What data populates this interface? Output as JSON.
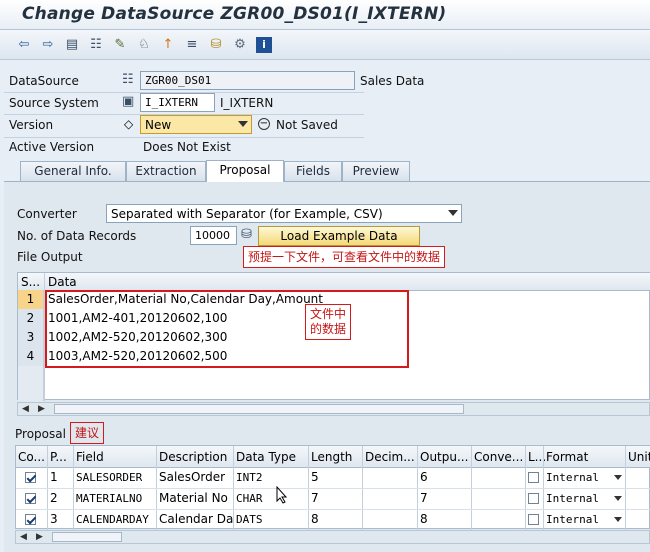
{
  "window": {
    "title": "Change DataSource ZGR00_DS01(I_IXTERN)"
  },
  "toolbar": {
    "icons": [
      "back-arrow-icon",
      "forward-arrow-icon",
      "display-icon",
      "hierarchy-icon",
      "edit-pencil-icon",
      "activate-icon",
      "info-marker-icon",
      "transport-icon",
      "database-icon",
      "settings-icon",
      "info-icon"
    ]
  },
  "header": {
    "datasource_label": "DataSource",
    "datasource_value": "ZGR00_DS01",
    "datasource_desc": "Sales Data",
    "source_system_label": "Source System",
    "source_system_value": "I_IXTERN",
    "source_system_desc": "I_IXTERN",
    "version_label": "Version",
    "version_value": "New",
    "version_status": "Not Saved",
    "active_version_label": "Active Version",
    "active_version_value": "Does Not Exist"
  },
  "tabs": [
    {
      "label": "General Info."
    },
    {
      "label": "Extraction"
    },
    {
      "label": "Proposal"
    },
    {
      "label": "Fields"
    },
    {
      "label": "Preview"
    }
  ],
  "proposal": {
    "converter_label": "Converter",
    "converter_value": "Separated with Separator (for Example, CSV)",
    "records_label": "No. of Data Records",
    "records_value": "10000",
    "load_button": "Load Example Data",
    "annotation_load": "预提一下文件，可查看文件中的数据",
    "file_output_label": "File Output",
    "file_grid": {
      "col_s": "S...",
      "col_data": "Data",
      "rows": [
        {
          "n": "1",
          "data": "SalesOrder,Material No,Calendar Day,Amount"
        },
        {
          "n": "2",
          "data": "1001,AM2-401,20120602,100"
        },
        {
          "n": "3",
          "data": "1002,AM2-520,20120602,300"
        },
        {
          "n": "4",
          "data": "1003,AM2-520,20120602,500"
        }
      ]
    },
    "annotation_file": "文件中\n的数据",
    "proposal_label": "Proposal",
    "annotation_proposal": "建议",
    "proposal_grid": {
      "headers": [
        "Co...",
        "P...",
        "Field",
        "Description",
        "Data Type",
        "Length",
        "Decim...",
        "Outpu...",
        "Conve...",
        "L...",
        "Format",
        "Unit"
      ],
      "rows": [
        {
          "pos": "1",
          "field": "SALESORDER",
          "desc": "SalesOrder",
          "type": "INT2",
          "length": "5",
          "output": "6",
          "format": "Internal"
        },
        {
          "pos": "2",
          "field": "MATERIALNO",
          "desc": "Material No",
          "type": "CHAR",
          "length": "7",
          "output": "7",
          "format": "Internal"
        },
        {
          "pos": "3",
          "field": "CALENDARDAY",
          "desc": "Calendar Day",
          "type": "DATS",
          "length": "8",
          "output": "8",
          "format": "Internal"
        }
      ]
    }
  },
  "colors": {
    "annotation_red": "#d41a1a",
    "highlight": "#f7d48a",
    "accent": "#2b5f9a"
  }
}
